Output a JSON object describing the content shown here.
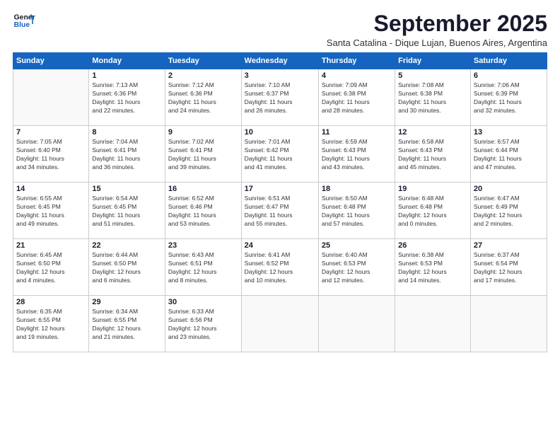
{
  "logo": {
    "line1": "General",
    "line2": "Blue"
  },
  "title": "September 2025",
  "subtitle": "Santa Catalina - Dique Lujan, Buenos Aires, Argentina",
  "days_of_week": [
    "Sunday",
    "Monday",
    "Tuesday",
    "Wednesday",
    "Thursday",
    "Friday",
    "Saturday"
  ],
  "weeks": [
    [
      {
        "day": "",
        "info": ""
      },
      {
        "day": "1",
        "info": "Sunrise: 7:13 AM\nSunset: 6:36 PM\nDaylight: 11 hours\nand 22 minutes."
      },
      {
        "day": "2",
        "info": "Sunrise: 7:12 AM\nSunset: 6:36 PM\nDaylight: 11 hours\nand 24 minutes."
      },
      {
        "day": "3",
        "info": "Sunrise: 7:10 AM\nSunset: 6:37 PM\nDaylight: 11 hours\nand 26 minutes."
      },
      {
        "day": "4",
        "info": "Sunrise: 7:09 AM\nSunset: 6:38 PM\nDaylight: 11 hours\nand 28 minutes."
      },
      {
        "day": "5",
        "info": "Sunrise: 7:08 AM\nSunset: 6:38 PM\nDaylight: 11 hours\nand 30 minutes."
      },
      {
        "day": "6",
        "info": "Sunrise: 7:06 AM\nSunset: 6:39 PM\nDaylight: 11 hours\nand 32 minutes."
      }
    ],
    [
      {
        "day": "7",
        "info": "Sunrise: 7:05 AM\nSunset: 6:40 PM\nDaylight: 11 hours\nand 34 minutes."
      },
      {
        "day": "8",
        "info": "Sunrise: 7:04 AM\nSunset: 6:41 PM\nDaylight: 11 hours\nand 36 minutes."
      },
      {
        "day": "9",
        "info": "Sunrise: 7:02 AM\nSunset: 6:41 PM\nDaylight: 11 hours\nand 39 minutes."
      },
      {
        "day": "10",
        "info": "Sunrise: 7:01 AM\nSunset: 6:42 PM\nDaylight: 11 hours\nand 41 minutes."
      },
      {
        "day": "11",
        "info": "Sunrise: 6:59 AM\nSunset: 6:43 PM\nDaylight: 11 hours\nand 43 minutes."
      },
      {
        "day": "12",
        "info": "Sunrise: 6:58 AM\nSunset: 6:43 PM\nDaylight: 11 hours\nand 45 minutes."
      },
      {
        "day": "13",
        "info": "Sunrise: 6:57 AM\nSunset: 6:44 PM\nDaylight: 11 hours\nand 47 minutes."
      }
    ],
    [
      {
        "day": "14",
        "info": "Sunrise: 6:55 AM\nSunset: 6:45 PM\nDaylight: 11 hours\nand 49 minutes."
      },
      {
        "day": "15",
        "info": "Sunrise: 6:54 AM\nSunset: 6:45 PM\nDaylight: 11 hours\nand 51 minutes."
      },
      {
        "day": "16",
        "info": "Sunrise: 6:52 AM\nSunset: 6:46 PM\nDaylight: 11 hours\nand 53 minutes."
      },
      {
        "day": "17",
        "info": "Sunrise: 6:51 AM\nSunset: 6:47 PM\nDaylight: 11 hours\nand 55 minutes."
      },
      {
        "day": "18",
        "info": "Sunrise: 6:50 AM\nSunset: 6:48 PM\nDaylight: 11 hours\nand 57 minutes."
      },
      {
        "day": "19",
        "info": "Sunrise: 6:48 AM\nSunset: 6:48 PM\nDaylight: 12 hours\nand 0 minutes."
      },
      {
        "day": "20",
        "info": "Sunrise: 6:47 AM\nSunset: 6:49 PM\nDaylight: 12 hours\nand 2 minutes."
      }
    ],
    [
      {
        "day": "21",
        "info": "Sunrise: 6:45 AM\nSunset: 6:50 PM\nDaylight: 12 hours\nand 4 minutes."
      },
      {
        "day": "22",
        "info": "Sunrise: 6:44 AM\nSunset: 6:50 PM\nDaylight: 12 hours\nand 6 minutes."
      },
      {
        "day": "23",
        "info": "Sunrise: 6:43 AM\nSunset: 6:51 PM\nDaylight: 12 hours\nand 8 minutes."
      },
      {
        "day": "24",
        "info": "Sunrise: 6:41 AM\nSunset: 6:52 PM\nDaylight: 12 hours\nand 10 minutes."
      },
      {
        "day": "25",
        "info": "Sunrise: 6:40 AM\nSunset: 6:53 PM\nDaylight: 12 hours\nand 12 minutes."
      },
      {
        "day": "26",
        "info": "Sunrise: 6:38 AM\nSunset: 6:53 PM\nDaylight: 12 hours\nand 14 minutes."
      },
      {
        "day": "27",
        "info": "Sunrise: 6:37 AM\nSunset: 6:54 PM\nDaylight: 12 hours\nand 17 minutes."
      }
    ],
    [
      {
        "day": "28",
        "info": "Sunrise: 6:35 AM\nSunset: 6:55 PM\nDaylight: 12 hours\nand 19 minutes."
      },
      {
        "day": "29",
        "info": "Sunrise: 6:34 AM\nSunset: 6:55 PM\nDaylight: 12 hours\nand 21 minutes."
      },
      {
        "day": "30",
        "info": "Sunrise: 6:33 AM\nSunset: 6:56 PM\nDaylight: 12 hours\nand 23 minutes."
      },
      {
        "day": "",
        "info": ""
      },
      {
        "day": "",
        "info": ""
      },
      {
        "day": "",
        "info": ""
      },
      {
        "day": "",
        "info": ""
      }
    ]
  ]
}
